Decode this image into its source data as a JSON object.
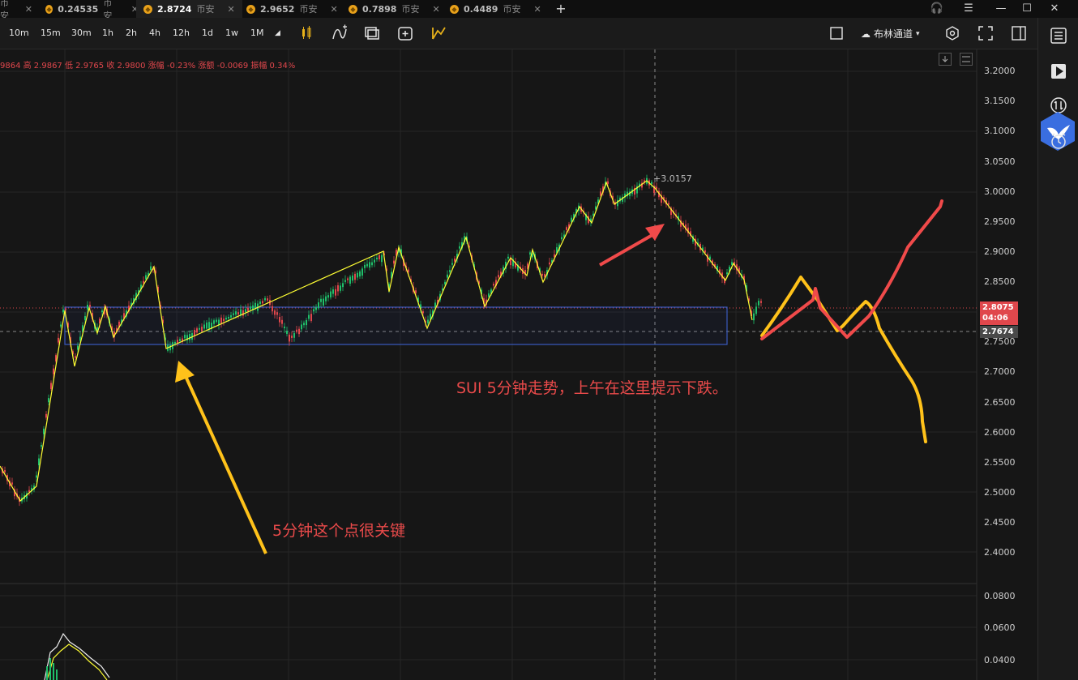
{
  "tabs": [
    {
      "price": "0.24535",
      "suffix": "币安"
    },
    {
      "price": "2.8724",
      "suffix": "币安"
    },
    {
      "price": "2.9652",
      "suffix": "币安"
    },
    {
      "price": "0.7898",
      "suffix": "币安"
    },
    {
      "price": "0.4489",
      "suffix": "币安"
    }
  ],
  "toolbar": {
    "timeframes": [
      "10m",
      "15m",
      "30m",
      "1h",
      "2h",
      "4h",
      "12h",
      "1d",
      "1w",
      "1M"
    ],
    "channel": "布林通道"
  },
  "ohlc": "9864  高 2.9867  低 2.9765  收 2.9800  涨幅 -0.23%  涨额 -0.0069  振幅 0.34%",
  "price_axis": {
    "main": [
      "3.2000",
      "3.1500",
      "3.1000",
      "3.0500",
      "3.0000",
      "2.9500",
      "2.9000",
      "2.8500",
      "2.8000",
      "2.7500",
      "2.7000",
      "2.6500",
      "2.6000",
      "2.5500",
      "2.5000",
      "2.4500",
      "2.4000"
    ],
    "current": {
      "price": "2.8075",
      "countdown": "04:06"
    },
    "crosshair": "2.7674",
    "indicator": [
      "0.0800",
      "0.0600",
      "0.0400"
    ]
  },
  "peak_label": "3.0157",
  "annotations": {
    "trend_note": "SUI  5分钟走势，上午在这里提示下跌。",
    "key_point": "5分钟这个点很关键"
  },
  "colors": {
    "up": "#1fbf6a",
    "down": "#e0474c",
    "zigzag": "#ffff33",
    "yellow_ink": "#ffc21a",
    "red_ink": "#f04a4a",
    "box": "#3a5bbf"
  }
}
